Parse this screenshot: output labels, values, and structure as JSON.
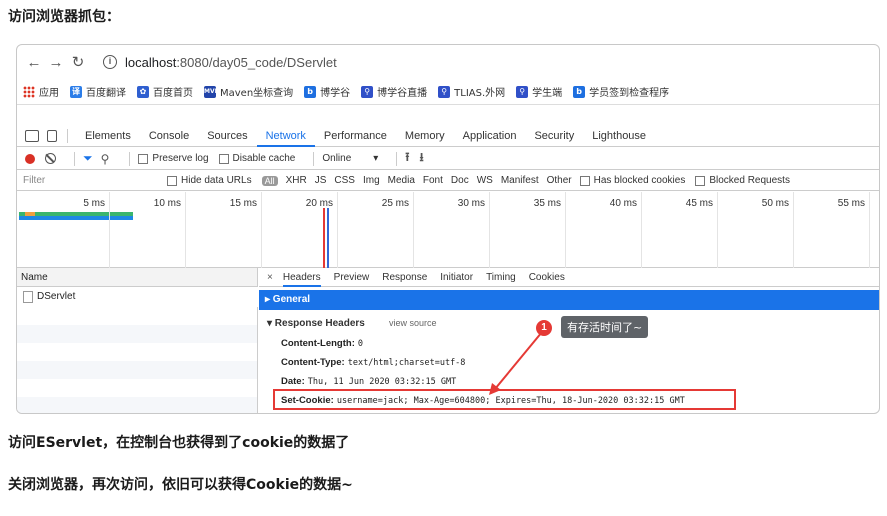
{
  "heading": "访问浏览器抓包：",
  "paragraph1": "访问EServlet，在控制台也获得到了cookie的数据了",
  "paragraph2": "关闭浏览器，再次访问，依旧可以获得Cookie的数据~",
  "browser": {
    "url_host": "localhost",
    "url_path": ":8080/day05_code/DServlet",
    "bookmarks": [
      "应用",
      "百度翻译",
      "百度首页",
      "Maven坐标查询",
      "博学谷",
      "博学谷直播",
      "TLIAS.外网",
      "学生端",
      "学员签到检查程序"
    ]
  },
  "devtools": {
    "tabs": [
      "Elements",
      "Console",
      "Sources",
      "Network",
      "Performance",
      "Memory",
      "Application",
      "Security",
      "Lighthouse"
    ],
    "active_tab": "Network",
    "toolbar": {
      "preserve_log": "Preserve log",
      "disable_cache": "Disable cache",
      "throttling": "Online"
    },
    "filter": {
      "placeholder": "Filter",
      "hide_data_urls": "Hide data URLs",
      "all": "All",
      "types": [
        "XHR",
        "JS",
        "CSS",
        "Img",
        "Media",
        "Font",
        "Doc",
        "WS",
        "Manifest",
        "Other"
      ],
      "has_blocked_cookies": "Has blocked cookies",
      "blocked_requests": "Blocked Requests"
    },
    "timeline_ticks": [
      "5 ms",
      "10 ms",
      "15 ms",
      "20 ms",
      "25 ms",
      "30 ms",
      "35 ms",
      "40 ms",
      "45 ms",
      "50 ms",
      "55 ms"
    ],
    "request_list": {
      "header": "Name",
      "rows": [
        "DServlet"
      ]
    },
    "detail_tabs": [
      "Headers",
      "Preview",
      "Response",
      "Initiator",
      "Timing",
      "Cookies"
    ],
    "general": "▸ General",
    "response_headers": "▾ Response Headers",
    "view_source": "view source",
    "headers": [
      {
        "key": "Content-Length:",
        "value": "0"
      },
      {
        "key": "Content-Type:",
        "value": "text/html;charset=utf-8"
      },
      {
        "key": "Date:",
        "value": "Thu, 11 Jun 2020 03:32:15 GMT"
      },
      {
        "key": "Set-Cookie:",
        "value": "username=jack; Max-Age=604800; Expires=Thu, 18-Jun-2020 03:32:15 GMT"
      }
    ]
  },
  "annotation": {
    "number": "1",
    "text": "有存活时间了~"
  }
}
